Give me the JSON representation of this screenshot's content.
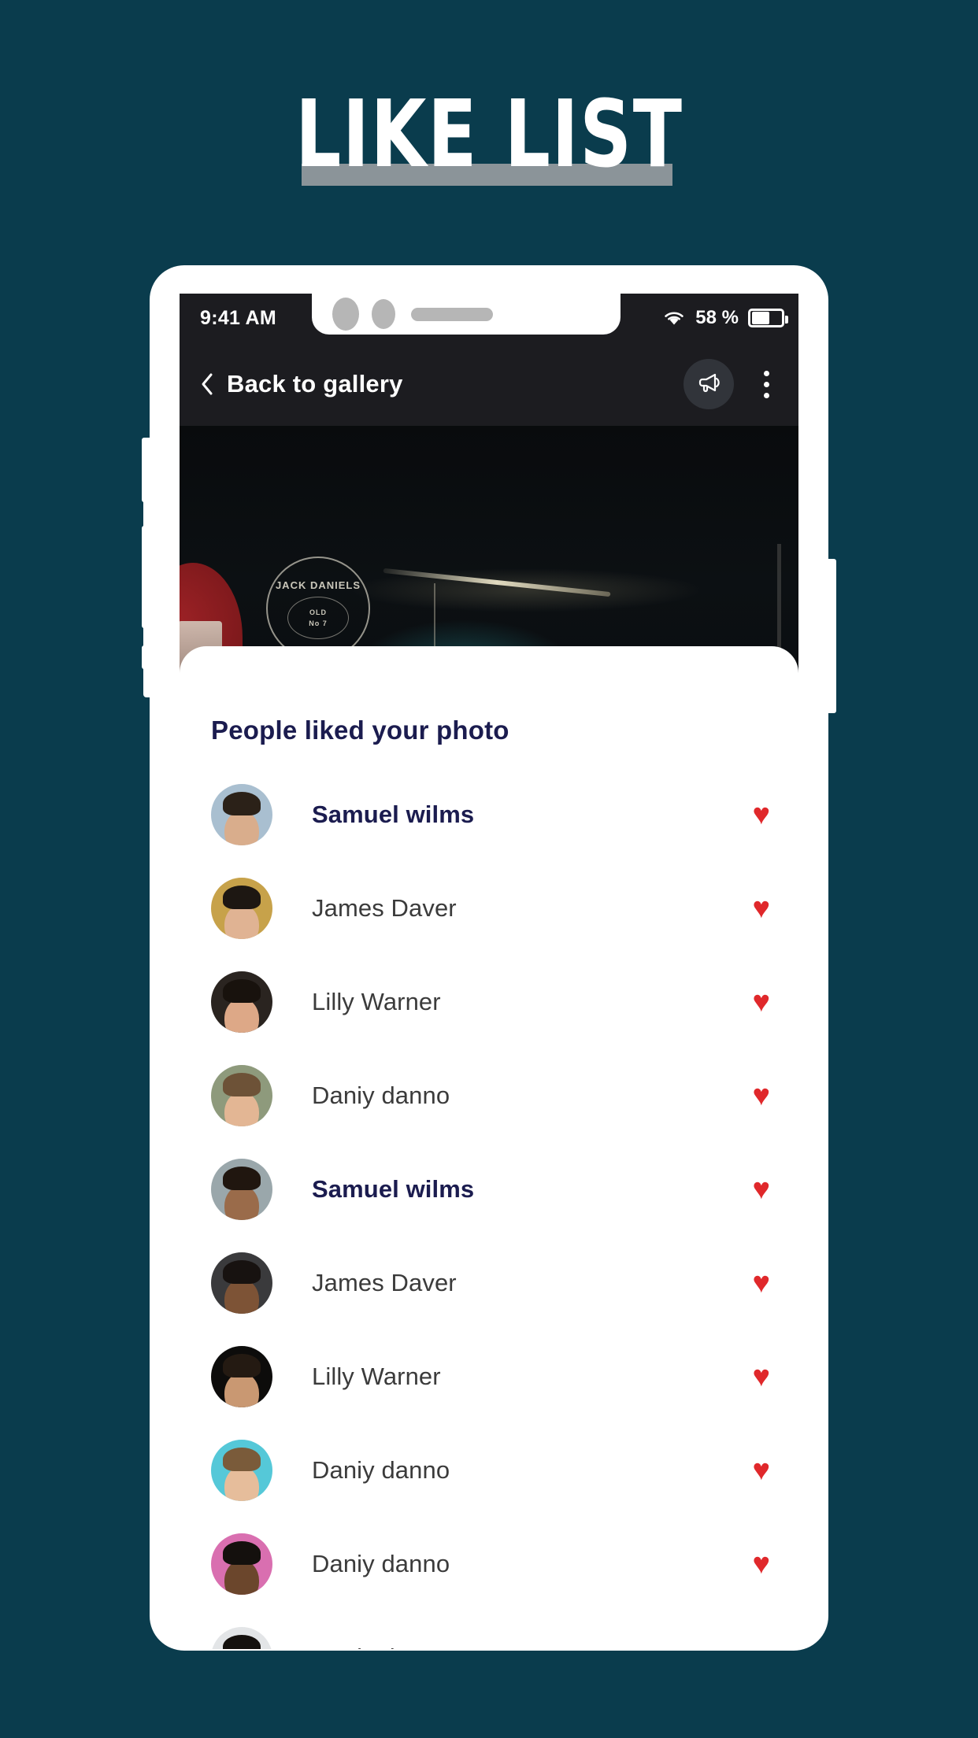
{
  "poster": {
    "title": "LIKE LIST",
    "background_color": "#0a3c4d",
    "underline_color": "#8b9499"
  },
  "phone": {
    "status_bar": {
      "time": "9:41 AM",
      "battery_percent": "58 %",
      "wifi_icon": "wifi-icon",
      "battery_icon": "battery-icon"
    },
    "nav_bar": {
      "back_label": "Back to gallery",
      "back_icon": "chevron-left-icon",
      "announce_icon": "megaphone-icon",
      "overflow_icon": "kebab-menu-icon"
    },
    "photo": {
      "alt": "dark bar interior with Jack Daniels sign",
      "sign_line1": "JACK DANIELS",
      "sign_line2": "OLD",
      "sign_line3": "No 7"
    },
    "sheet": {
      "title": "People liked your photo",
      "heart_icon": "heart-icon",
      "heart_color": "#e0282b",
      "highlight_color": "#1b1c4f",
      "likes": [
        {
          "name": "Samuel wilms",
          "highlighted": true,
          "liked": true,
          "skin": "#d9ad8c",
          "hair": "#2b2118",
          "bg": "#a9bfd0"
        },
        {
          "name": "James Daver",
          "highlighted": false,
          "liked": true,
          "skin": "#e0b393",
          "hair": "#1d1712",
          "bg": "#c7a24a"
        },
        {
          "name": "Lilly Warner",
          "highlighted": false,
          "liked": true,
          "skin": "#dda887",
          "hair": "#18120d",
          "bg": "#2a2420"
        },
        {
          "name": "Daniy danno",
          "highlighted": false,
          "liked": true,
          "skin": "#e3b694",
          "hair": "#6d5237",
          "bg": "#8e9a7c"
        },
        {
          "name": "Samuel wilms",
          "highlighted": true,
          "liked": true,
          "skin": "#9a6b4a",
          "hair": "#20160f",
          "bg": "#9aa7ab"
        },
        {
          "name": "James Daver",
          "highlighted": false,
          "liked": true,
          "skin": "#7d5336",
          "hair": "#171210",
          "bg": "#3a3a3c"
        },
        {
          "name": "Lilly Warner",
          "highlighted": false,
          "liked": true,
          "skin": "#c99872",
          "hair": "#241a12",
          "bg": "#0d0c0b"
        },
        {
          "name": "Daniy danno",
          "highlighted": false,
          "liked": true,
          "skin": "#e6bd9b",
          "hair": "#7a5b3a",
          "bg": "#55c8d8"
        },
        {
          "name": "Daniy danno",
          "highlighted": false,
          "liked": true,
          "skin": "#6b462c",
          "hair": "#14100d",
          "bg": "#d96fb0"
        },
        {
          "name": "Daniy danno",
          "highlighted": false,
          "liked": true,
          "skin": "#e9d2bd",
          "hair": "#15110e",
          "bg": "#e3e5e7"
        }
      ]
    }
  }
}
